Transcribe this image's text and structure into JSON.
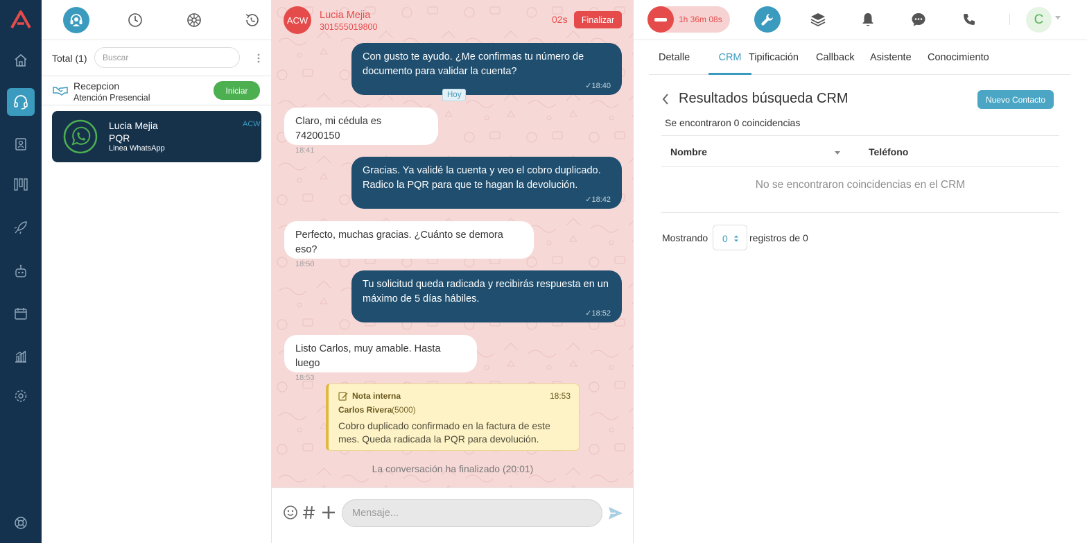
{
  "colors": {
    "rail": "#14324d",
    "accent": "#3b9bbf",
    "danger": "#e54b4b",
    "success": "#4caf50",
    "outgoing_bubble": "#1f4e6e",
    "chat_background": "#f6d9d7",
    "note_background": "#fdf3c6"
  },
  "rail": {
    "logo_icon": "app-logo",
    "items": [
      {
        "icon": "home-icon",
        "active": false
      },
      {
        "icon": "headset-icon",
        "active": true
      },
      {
        "icon": "contacts-book-icon",
        "active": false
      },
      {
        "icon": "kanban-icon",
        "active": false
      },
      {
        "icon": "rocket-icon",
        "active": false
      },
      {
        "icon": "robot-icon",
        "active": false
      },
      {
        "icon": "calendar-icon",
        "active": false
      },
      {
        "icon": "reports-chart-icon",
        "active": false
      },
      {
        "icon": "settings-gear-icon",
        "active": false
      },
      {
        "icon": "help-lifebuoy-icon",
        "active": false
      }
    ]
  },
  "queue": {
    "top_icons": [
      "support-agent-icon",
      "clock-history-icon",
      "omnichannel-wheel-icon",
      "call-history-icon"
    ],
    "total_label": "Total (1)",
    "search_placeholder": "Buscar",
    "reception": {
      "title": "Recepcion",
      "subtitle": "Atención Presencial",
      "button": "Iniciar"
    },
    "conversation": {
      "name": "Lucia Mejia",
      "topic": "PQR",
      "line": "Linea WhatsApp",
      "state": "ACW"
    }
  },
  "chat": {
    "header": {
      "avatar_text": "ACW",
      "contact_name": "Lucia Mejia",
      "contact_phone": "301555019800",
      "timer": "02s",
      "finish_button": "Finalizar"
    },
    "day_label": "Hoy",
    "messages": [
      {
        "text": "Con gusto te ayudo. ¿Me confirmas tu número de documento para validar la cuenta?",
        "time": "✓18:40"
      },
      {
        "text": "Claro, mi cédula es 74200150",
        "time": "18:41"
      },
      {
        "text": "Gracias. Ya validé la cuenta y veo el cobro duplicado. Radico la PQR para que te hagan la devolución.",
        "time": "✓18:42"
      },
      {
        "text": "Perfecto, muchas gracias. ¿Cuánto se demora eso?",
        "time": "18:50"
      },
      {
        "text": "Tu solicitud queda radicada y recibirás respuesta en un máximo de 5 días hábiles.",
        "time": "✓18:52"
      },
      {
        "text": "Listo Carlos, muy amable. Hasta luego",
        "time": "18:53"
      }
    ],
    "note": {
      "label": "Nota interna",
      "time": "18:53",
      "author": "Carlos Rivera",
      "extension": "(5000)",
      "text": "Cobro duplicado confirmado en la factura de este mes. Queda radicada la PQR para devolución."
    },
    "ended_text": "La conversación ha finalizado (20:01)",
    "composer": {
      "placeholder": "Mensaje...",
      "icons": [
        "emoji-icon",
        "hashtag-icon",
        "plus-icon",
        "send-icon"
      ]
    }
  },
  "topbar": {
    "status_time": "1h 36m 08s",
    "icons": [
      "wrench-icon",
      "layers-icon",
      "bell-icon",
      "chat-bubble-icon",
      "phone-icon"
    ],
    "user_initial": "C"
  },
  "tabs": {
    "items": [
      "Detalle",
      "CRM",
      "Tipificación",
      "Callback",
      "Asistente",
      "Conocimiento"
    ],
    "active": "CRM"
  },
  "crm": {
    "title": "Resultados búsqueda CRM",
    "new_contact_button": "Nuevo Contacto",
    "matches_text": "Se encontraron 0 coincidencias",
    "columns": [
      "Nombre",
      "Teléfono"
    ],
    "empty_text": "No se encontraron coincidencias en el CRM",
    "showing_label": "Mostrando",
    "page_size": "0",
    "records_label": "registros de 0"
  }
}
